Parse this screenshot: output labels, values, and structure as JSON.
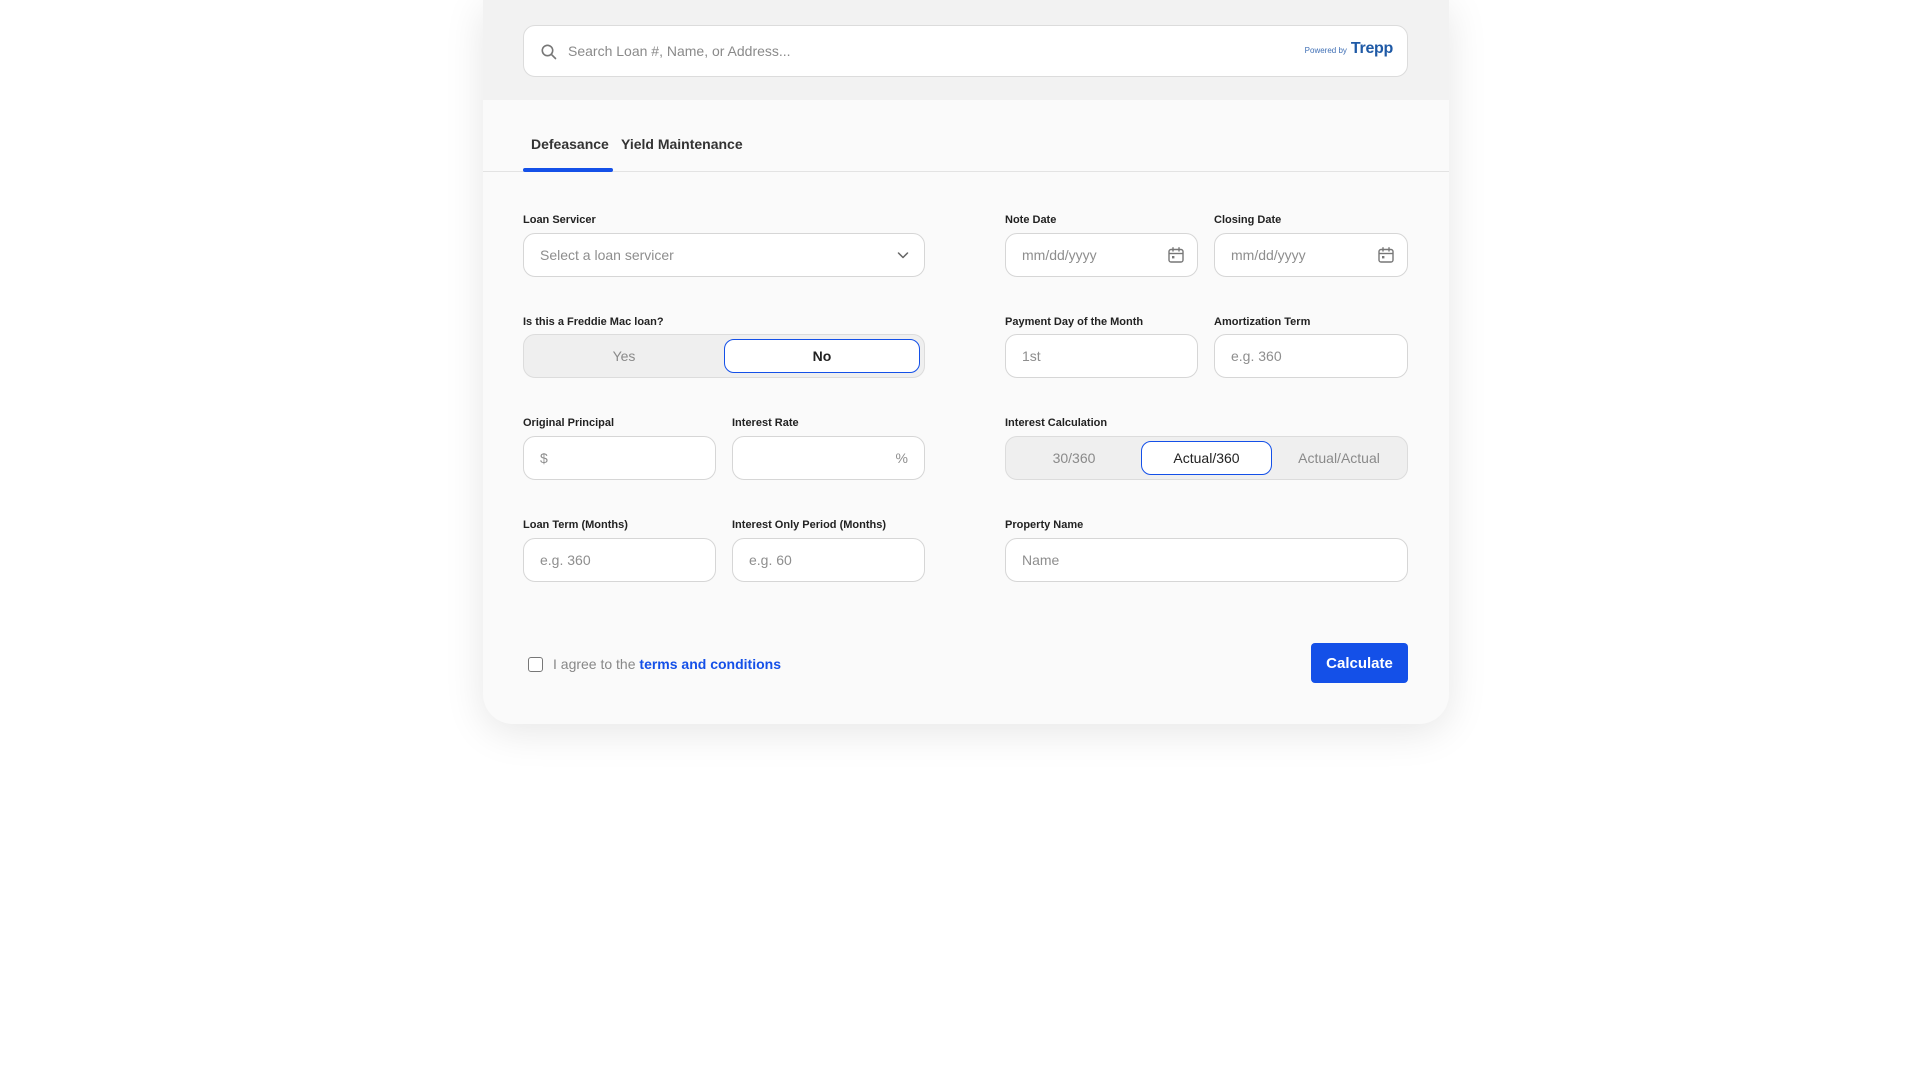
{
  "search": {
    "placeholder": "Search Loan #, Name, or Address...",
    "powered_by": "Powered by",
    "brand": "Trepp"
  },
  "tabs": [
    {
      "label": "Defeasance",
      "active": true
    },
    {
      "label": "Yield Maintenance",
      "active": false
    }
  ],
  "form": {
    "loan_servicer": {
      "label": "Loan Servicer",
      "placeholder": "Select a loan servicer"
    },
    "note_date": {
      "label": "Note Date",
      "placeholder": "mm/dd/yyyy"
    },
    "closing_date": {
      "label": "Closing Date",
      "placeholder": "mm/dd/yyyy"
    },
    "freddie_mac": {
      "label": "Is this a Freddie Mac loan?",
      "options": [
        "Yes",
        "No"
      ],
      "selected": "No"
    },
    "payment_day": {
      "label": "Payment Day of the Month",
      "placeholder": "1st"
    },
    "amortization_term": {
      "label": "Amortization Term",
      "placeholder": "e.g. 360"
    },
    "original_principal": {
      "label": "Original Principal",
      "prefix": "$"
    },
    "interest_rate": {
      "label": "Interest Rate",
      "suffix": "%"
    },
    "interest_calculation": {
      "label": "Interest Calculation",
      "options": [
        "30/360",
        "Actual/360",
        "Actual/Actual"
      ],
      "selected": "Actual/360"
    },
    "loan_term": {
      "label": "Loan Term (Months)",
      "placeholder": "e.g. 360"
    },
    "interest_only": {
      "label": "Interest Only Period (Months)",
      "placeholder": "e.g. 60"
    },
    "property_name": {
      "label": "Property Name",
      "placeholder": "Name"
    }
  },
  "footer": {
    "agree_prefix": "I agree to the",
    "terms_link": "terms and conditions",
    "calculate_label": "Calculate"
  },
  "colors": {
    "accent": "#1450e8",
    "brand": "#1f5aa6"
  }
}
